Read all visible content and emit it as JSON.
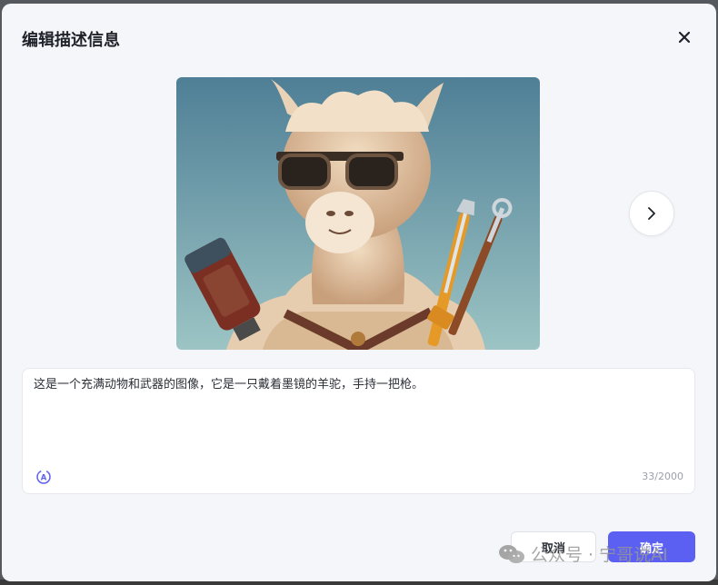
{
  "dialog": {
    "title": "编辑描述信息",
    "description": "这是一个充满动物和武器的图像，它是一只戴着墨镜的羊驼，手持一把枪。",
    "char_count": "33/2000",
    "cancel_label": "取消",
    "confirm_label": "确定"
  },
  "icons": {
    "close": "close-icon",
    "next": "chevron-right-icon",
    "ai_rewrite": "ai-rewrite-icon"
  },
  "watermark": {
    "text": "公众号 · 宁哥说AI"
  },
  "colors": {
    "primary": "#5b5ff2",
    "background": "#f5f6fa",
    "image_sky": "#5a8ea3"
  }
}
